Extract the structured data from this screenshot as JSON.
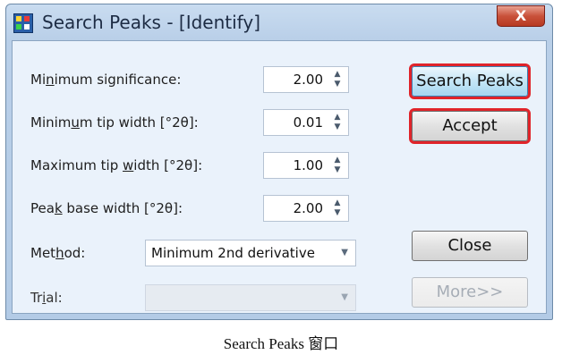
{
  "window": {
    "title": "Search Peaks - [Identify]",
    "close_glyph": "X"
  },
  "fields": [
    {
      "label_pre": "Mi",
      "label_key": "n",
      "label_post": "imum significance:",
      "value": "2.00"
    },
    {
      "label_pre": "Minim",
      "label_key": "u",
      "label_post": "m tip width [°2θ]:",
      "value": "0.01"
    },
    {
      "label_pre": "Maximum tip ",
      "label_key": "w",
      "label_post": "idth [°2θ]:",
      "value": "1.00"
    },
    {
      "label_pre": "Pea",
      "label_key": "k",
      "label_post": " base width [°2θ]:",
      "value": "2.00"
    }
  ],
  "method": {
    "label_pre": "Met",
    "label_key": "h",
    "label_post": "od:",
    "value": "Minimum 2nd derivative"
  },
  "trial": {
    "label_pre": "Tr",
    "label_key": "i",
    "label_post": "al:",
    "value": ""
  },
  "buttons": {
    "search_peaks": "Search Peaks",
    "accept": "Accept",
    "close": "Close",
    "more": "More>>"
  },
  "caption": "Search Peaks 窗口"
}
